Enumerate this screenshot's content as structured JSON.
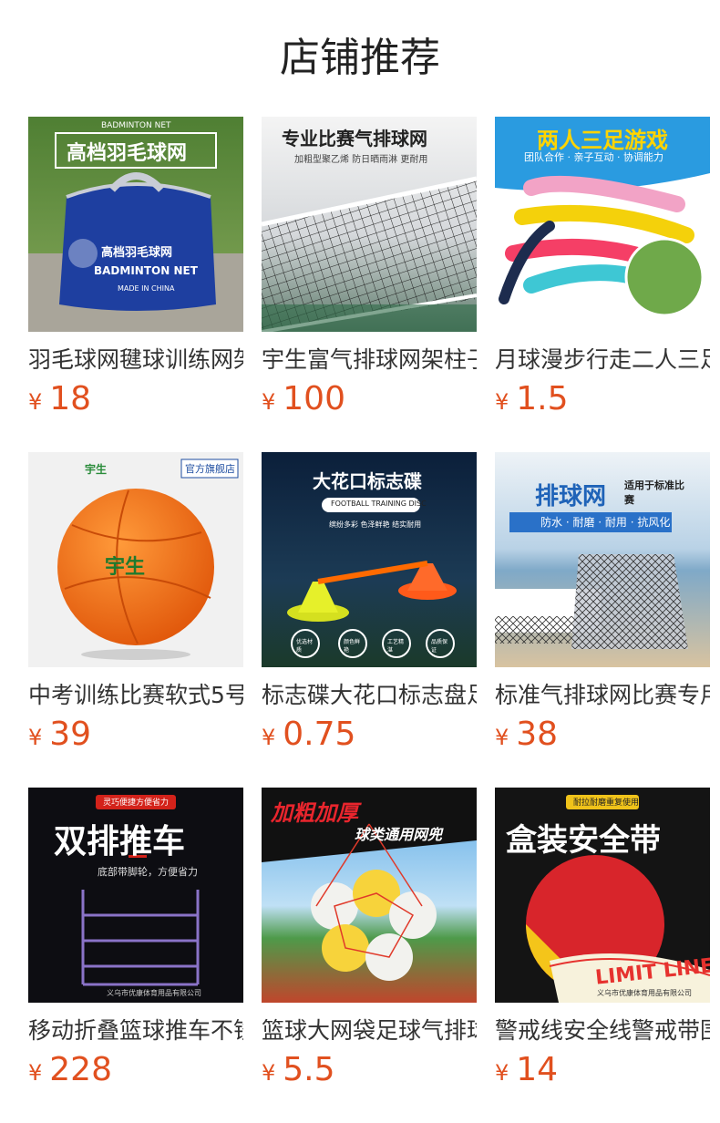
{
  "page": {
    "title": "店铺推荐"
  },
  "currency": "¥",
  "products": [
    {
      "name": "羽毛球网毽球训练网架",
      "price": "18",
      "image": {
        "headline": "高档羽毛球网",
        "sub": "BADMINTON NET",
        "bag_text": "高档羽毛球网",
        "bag_en": "BADMINTON NET",
        "bag_small": "MADE IN CHINA"
      }
    },
    {
      "name": "宇生富气排球网架柱子",
      "price": "100",
      "image": {
        "headline": "专业比赛气排球网",
        "sub": "加粗型聚乙烯 防日晒雨淋 更耐用"
      }
    },
    {
      "name": "月球漫步行走二人三足",
      "price": "1.5",
      "image": {
        "headline": "两人三足游戏",
        "sub": "团队合作 · 亲子互动 · 协调能力"
      }
    },
    {
      "name": "中考训练比赛软式5号",
      "price": "39",
      "image": {
        "badge": "官方旗舰店",
        "brand": "宇生"
      }
    },
    {
      "name": "标志碟大花口标志盘足",
      "price": "0.75",
      "image": {
        "headline": "大花口标志碟",
        "sub": "FOOTBALL TRAINING DISC",
        "tagline": "缤纷多彩 色泽鲜艳 结实耐用",
        "icons": [
          "优选材质",
          "颜色鲜艳",
          "工艺精湛",
          "品质保证"
        ]
      }
    },
    {
      "name": "标准气排球网比赛专用",
      "price": "38",
      "image": {
        "headline": "排球网",
        "side": "适用于标准比赛",
        "sub": "防水 · 耐磨 · 耐用 · 抗风化"
      }
    },
    {
      "name": "移动折叠篮球推车不锈",
      "price": "228",
      "image": {
        "tag": "灵巧便捷方便省力",
        "headline": "双排推车",
        "sub": "底部带脚轮，方便省力",
        "footer": "义乌市优康体育用品有限公司"
      }
    },
    {
      "name": "篮球大网袋足球气排球",
      "price": "5.5",
      "image": {
        "headline": "加粗加厚",
        "sub": "球类通用网兜"
      }
    },
    {
      "name": "警戒线安全线警戒带围",
      "price": "14",
      "image": {
        "tag": "耐拉耐磨重复使用",
        "headline": "盒装安全带",
        "tape": "LIMIT LINE",
        "footer": "义乌市优康体育用品有限公司"
      }
    }
  ],
  "colors": {
    "price": "#e1501f",
    "title": "#222222",
    "name": "#333333"
  }
}
